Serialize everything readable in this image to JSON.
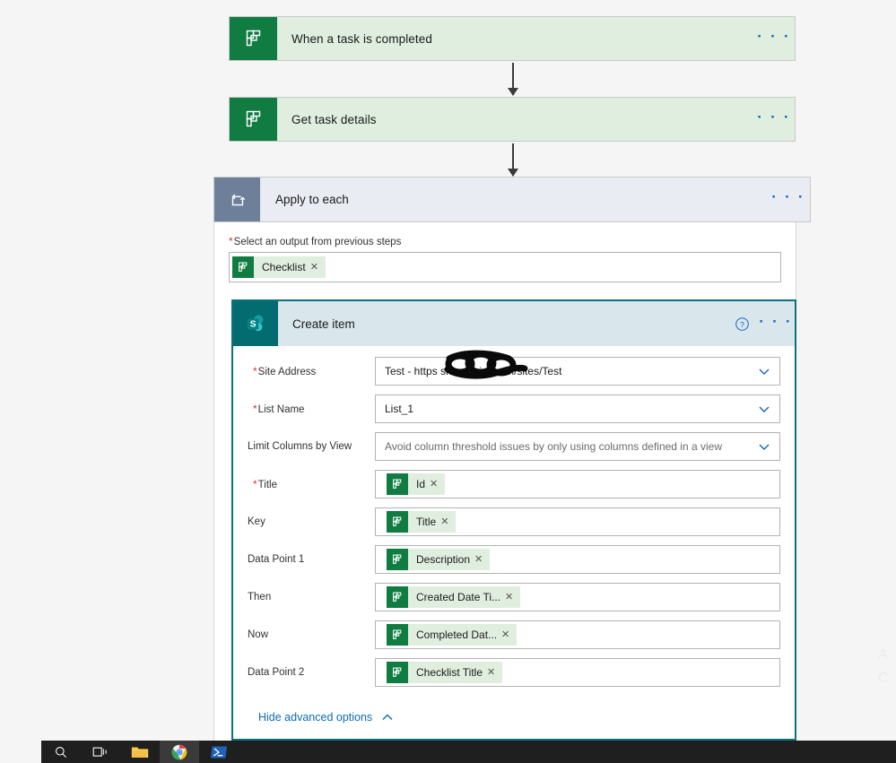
{
  "app": {
    "background_color": "#f5f5f5",
    "canvas_name": "power-automate-flow-designer"
  },
  "flow": {
    "steps": [
      {
        "id": "trigger",
        "title": "When a task is completed",
        "icon": "planner-icon",
        "icon_color": "#107c41",
        "header_color": "#dfeede",
        "ellipsis": "· · ·"
      },
      {
        "id": "get_task_details",
        "title": "Get task details",
        "icon": "planner-icon",
        "icon_color": "#107c41",
        "header_color": "#dfeede",
        "ellipsis": "· · ·"
      }
    ]
  },
  "apply_to_each": {
    "title": "Apply to each",
    "icon": "loop-icon",
    "icon_color": "#6e8099",
    "header_color": "#eaecf3",
    "ellipsis": "· · ·",
    "output_field": {
      "required_marker": "*",
      "label": "Select an output from previous steps",
      "token": {
        "label": "Checklist",
        "icon": "planner-icon",
        "remove": "✕"
      }
    }
  },
  "create_item": {
    "title": "Create item",
    "icon": "sharepoint-icon",
    "icon_color": "#036c70",
    "header_color": "#d9e6ec",
    "border_color": "#0b717f",
    "help_icon": "help-circle-icon",
    "ellipsis": "· · ·",
    "fields": [
      {
        "name": "site-address",
        "label": "Site Address",
        "required": true,
        "type": "select",
        "value": "Test - https                sharepoint.com/sites/Test",
        "redacted": true,
        "chevron": "chevron-down-icon"
      },
      {
        "name": "list-name",
        "label": "List Name",
        "required": true,
        "type": "select",
        "value": "List_1",
        "redacted": false,
        "chevron": "chevron-down-icon"
      },
      {
        "name": "limit-columns-by-view",
        "label": "Limit Columns by View",
        "required": false,
        "type": "select",
        "value": "Avoid column threshold issues by only using columns defined in a view",
        "is_placeholder": true,
        "redacted": false,
        "chevron": "chevron-down-icon"
      },
      {
        "name": "title",
        "label": "Title",
        "required": true,
        "type": "token",
        "token": {
          "label": "Id",
          "icon": "planner-icon",
          "remove": "✕"
        }
      },
      {
        "name": "key",
        "label": "Key",
        "required": false,
        "type": "token",
        "token": {
          "label": "Title",
          "icon": "planner-icon",
          "remove": "✕"
        }
      },
      {
        "name": "data-point-1",
        "label": "Data Point 1",
        "required": false,
        "type": "token",
        "token": {
          "label": "Description",
          "icon": "planner-icon",
          "remove": "✕"
        }
      },
      {
        "name": "then",
        "label": "Then",
        "required": false,
        "type": "token",
        "token": {
          "label": "Created Date Ti...",
          "icon": "planner-icon",
          "remove": "✕"
        }
      },
      {
        "name": "now",
        "label": "Now",
        "required": false,
        "type": "token",
        "token": {
          "label": "Completed Dat...",
          "icon": "planner-icon",
          "remove": "✕"
        }
      },
      {
        "name": "data-point-2",
        "label": "Data Point 2",
        "required": false,
        "type": "token",
        "token": {
          "label": "Checklist Title",
          "icon": "planner-icon",
          "remove": "✕"
        }
      }
    ],
    "advanced_options": {
      "label": "Hide advanced options",
      "chevron": "chevron-up-icon"
    }
  },
  "taskbar": {
    "background_color": "#1f1f1f",
    "items": [
      {
        "name": "search-icon",
        "label": "Search"
      },
      {
        "name": "task-view-icon",
        "label": "Task View"
      },
      {
        "name": "file-explorer-icon",
        "label": "File Explorer"
      },
      {
        "name": "chrome-icon",
        "label": "Google Chrome",
        "active": true
      },
      {
        "name": "powershell-icon",
        "label": "Windows PowerShell"
      }
    ]
  }
}
